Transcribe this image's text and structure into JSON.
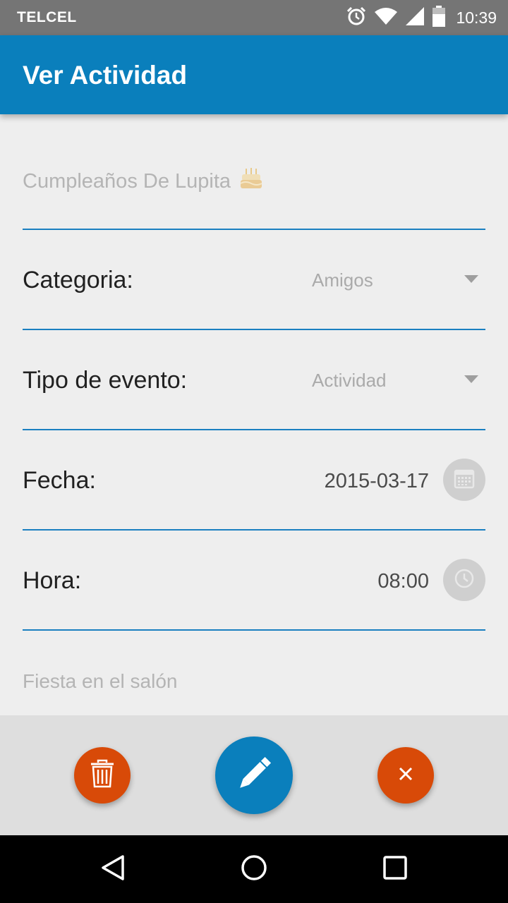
{
  "status_bar": {
    "carrier": "TELCEL",
    "time": "10:39",
    "icons": [
      "alarm-icon",
      "wifi-icon",
      "signal-icon",
      "battery-icon"
    ]
  },
  "app_bar": {
    "title": "Ver Actividad"
  },
  "form": {
    "title_value": "Cumpleaños De Lupita",
    "title_emoji": "birthday-cake-icon",
    "categoria": {
      "label": "Categoria:",
      "value": "Amigos"
    },
    "tipo_evento": {
      "label": "Tipo de evento:",
      "value": "Actividad"
    },
    "fecha": {
      "label": "Fecha:",
      "value": "2015-03-17",
      "button_icon": "calendar-icon"
    },
    "hora": {
      "label": "Hora:",
      "value": "08:00",
      "button_icon": "clock-icon"
    },
    "description": "Fiesta en el salón"
  },
  "actions": {
    "delete_icon": "trash-icon",
    "edit_icon": "pencil-icon",
    "close_icon": "close-icon"
  },
  "nav": [
    "back-icon",
    "home-icon",
    "recents-icon"
  ],
  "colors": {
    "primary": "#0a7fbc",
    "accent": "#d84a08",
    "status_bar": "#757575",
    "background": "#eeeeee",
    "bottom_bar": "#dedede",
    "divider": "#1a7fc0"
  }
}
